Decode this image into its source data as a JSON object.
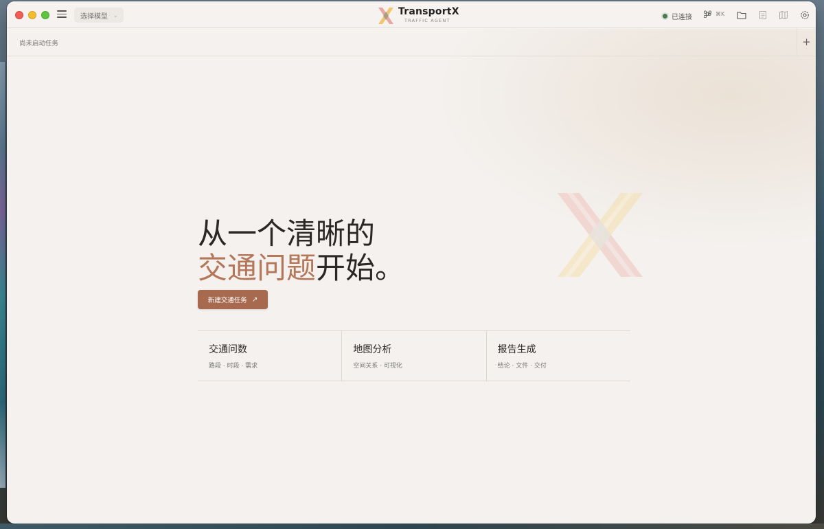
{
  "titlebar": {
    "model_select_label": "选择模型",
    "brand_name": "TransportX",
    "brand_sub": "TRAFFIC AGENT",
    "status_label": "已连接",
    "shortcut_label": "⌘K"
  },
  "taskbar": {
    "empty_label": "尚未启动任务",
    "add_label": "+"
  },
  "hero": {
    "line1": "从一个清晰的",
    "line2_accent": "交通问题",
    "line2_rest": "开始。",
    "cta_label": "新建交通任务",
    "cta_arrow": "↗"
  },
  "cards": [
    {
      "title": "交通问数",
      "subtitle": "路段 · 时段 · 需求"
    },
    {
      "title": "地图分析",
      "subtitle": "空间关系 · 可视化"
    },
    {
      "title": "报告生成",
      "subtitle": "结论 · 文件 · 交付"
    }
  ],
  "colors": {
    "accent": "#b5775a",
    "button": "#a86a4f",
    "status_ok": "#4c7a55",
    "background": "#f4f1ee"
  }
}
